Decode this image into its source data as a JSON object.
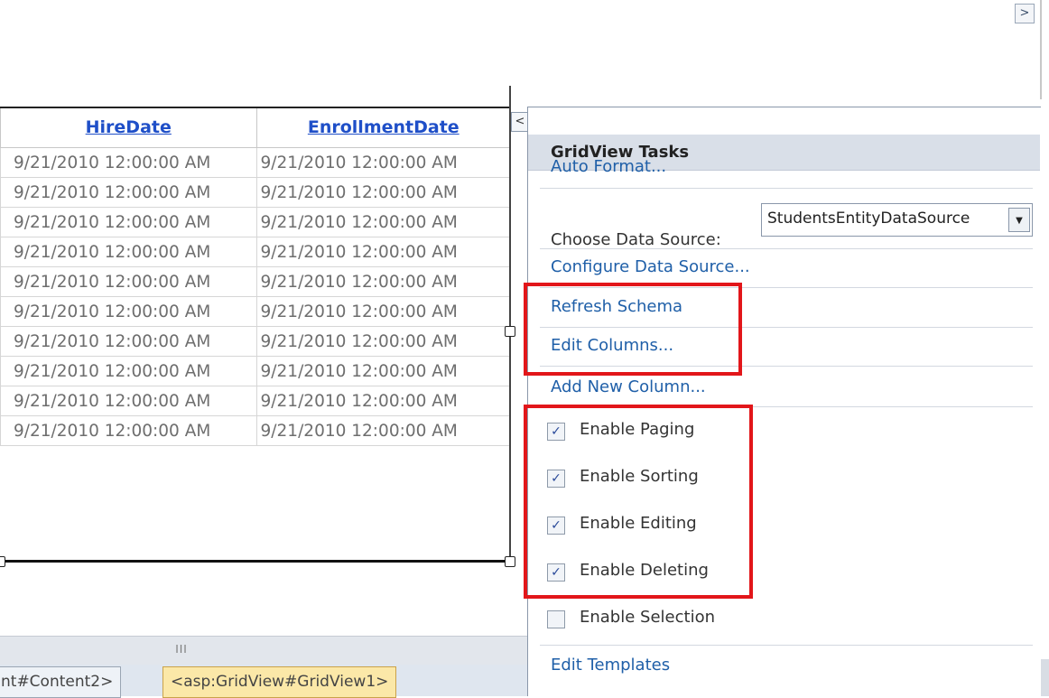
{
  "grid": {
    "headers": [
      "HireDate",
      "EnrollmentDate"
    ],
    "rows": [
      [
        "9/21/2010 12:00:00 AM",
        "9/21/2010 12:00:00 AM"
      ],
      [
        "9/21/2010 12:00:00 AM",
        "9/21/2010 12:00:00 AM"
      ],
      [
        "9/21/2010 12:00:00 AM",
        "9/21/2010 12:00:00 AM"
      ],
      [
        "9/21/2010 12:00:00 AM",
        "9/21/2010 12:00:00 AM"
      ],
      [
        "9/21/2010 12:00:00 AM",
        "9/21/2010 12:00:00 AM"
      ],
      [
        "9/21/2010 12:00:00 AM",
        "9/21/2010 12:00:00 AM"
      ],
      [
        "9/21/2010 12:00:00 AM",
        "9/21/2010 12:00:00 AM"
      ],
      [
        "9/21/2010 12:00:00 AM",
        "9/21/2010 12:00:00 AM"
      ],
      [
        "9/21/2010 12:00:00 AM",
        "9/21/2010 12:00:00 AM"
      ],
      [
        "9/21/2010 12:00:00 AM",
        "9/21/2010 12:00:00 AM"
      ]
    ]
  },
  "icons": {
    "top_arrow": ">",
    "collapse_arrow": "<",
    "dropdown": "▼",
    "check": "✓",
    "scroll_grip": "III"
  },
  "tasks": {
    "title": "GridView Tasks",
    "auto_format": "Auto Format...",
    "choose_data_source_label": "Choose Data Source:",
    "data_source_value": "StudentsEntityDataSource",
    "configure_data_source": "Configure Data Source...",
    "refresh_schema": "Refresh Schema",
    "edit_columns": "Edit Columns...",
    "add_new_column": "Add New Column...",
    "options": [
      {
        "label": "Enable Paging",
        "checked": true
      },
      {
        "label": "Enable Sorting",
        "checked": true
      },
      {
        "label": "Enable Editing",
        "checked": true
      },
      {
        "label": "Enable Deleting",
        "checked": true
      },
      {
        "label": "Enable Selection",
        "checked": false
      }
    ],
    "edit_templates": "Edit Templates"
  },
  "tagbar": {
    "content_tag": "nt#Content2>",
    "gridview_tag": "<asp:GridView#GridView1>"
  },
  "colors": {
    "highlight": "#e2161a",
    "link": "#1f5fa8",
    "header_link": "#1f4fc8",
    "selected_tag": "#fbe8a8"
  }
}
